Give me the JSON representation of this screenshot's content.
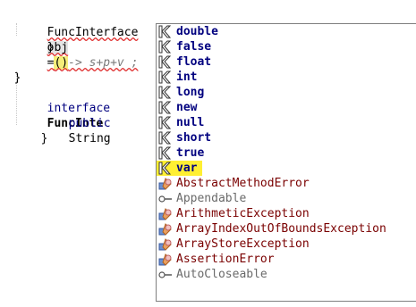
{
  "editor": {
    "line1": {
      "type": "FuncInterface",
      "var_name": "obj",
      "assign": "=",
      "parens": "()",
      "lambda_rest": "-> s+p+v ;"
    },
    "line2": "}",
    "line3": "}",
    "line4": {
      "keyword": "interface",
      "name_partial": "FuncInte"
    },
    "line5": {
      "modifier": "public",
      "type": "String"
    },
    "line6": "}"
  },
  "completion": {
    "items": [
      {
        "label": "double",
        "kind": "keyword",
        "icon": "keyword-icon"
      },
      {
        "label": "false",
        "kind": "keyword",
        "icon": "keyword-icon"
      },
      {
        "label": "float",
        "kind": "keyword",
        "icon": "keyword-icon"
      },
      {
        "label": "int",
        "kind": "keyword",
        "icon": "keyword-icon"
      },
      {
        "label": "long",
        "kind": "keyword",
        "icon": "keyword-icon"
      },
      {
        "label": "new",
        "kind": "keyword",
        "icon": "keyword-icon"
      },
      {
        "label": "null",
        "kind": "keyword",
        "icon": "keyword-icon"
      },
      {
        "label": "short",
        "kind": "keyword",
        "icon": "keyword-icon"
      },
      {
        "label": "true",
        "kind": "keyword",
        "icon": "keyword-icon"
      },
      {
        "label": "var",
        "kind": "keyword",
        "icon": "keyword-icon",
        "selected": true
      },
      {
        "label": "AbstractMethodError",
        "kind": "class",
        "icon": "class-icon"
      },
      {
        "label": "Appendable",
        "kind": "interface",
        "icon": "interface-icon"
      },
      {
        "label": "ArithmeticException",
        "kind": "class",
        "icon": "class-icon"
      },
      {
        "label": "ArrayIndexOutOfBoundsException",
        "kind": "class",
        "icon": "class-icon"
      },
      {
        "label": "ArrayStoreException",
        "kind": "class",
        "icon": "class-icon"
      },
      {
        "label": "AssertionError",
        "kind": "class",
        "icon": "class-icon"
      },
      {
        "label": "AutoCloseable",
        "kind": "interface",
        "icon": "interface-icon"
      }
    ]
  },
  "colors": {
    "keyword": "#00007f",
    "class": "#7a0000",
    "interface": "#6a6a6a",
    "selection": "#ffef33",
    "error_underline": "#e03030"
  }
}
